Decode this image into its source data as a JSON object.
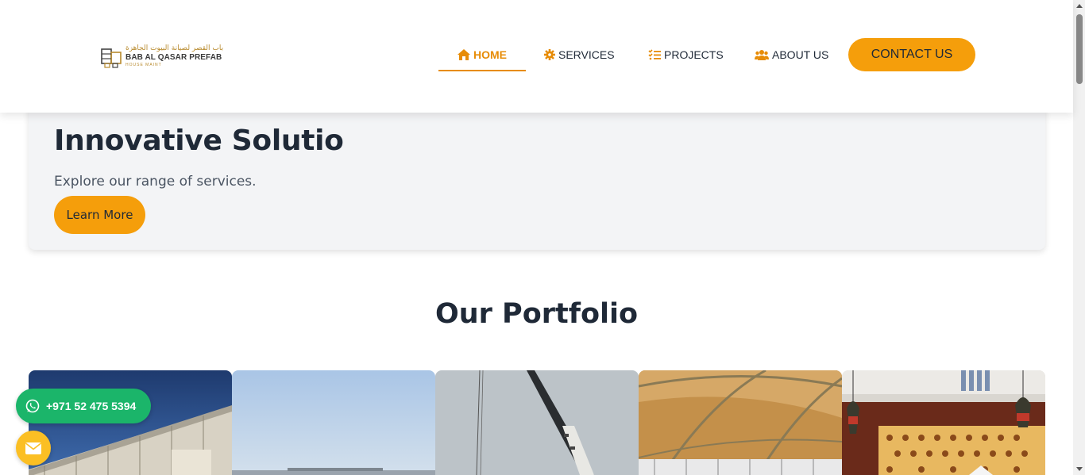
{
  "header": {
    "logo": {
      "arabic": "باب القصر لصيانة البيوت الجاهزة",
      "name": "BAB AL QASAR PREFAB",
      "sub": "HOUSE MAINT"
    },
    "nav": [
      {
        "label": "HOME",
        "icon": "home-icon",
        "active": true
      },
      {
        "label": "SERVICES",
        "icon": "gear-icon",
        "active": false
      },
      {
        "label": "PROJECTS",
        "icon": "list-check-icon",
        "active": false
      },
      {
        "label": "ABOUT US",
        "icon": "users-icon",
        "active": false
      }
    ],
    "contact_label": "CONTACT US"
  },
  "hero": {
    "title": "Innovative Solutio",
    "subtitle": "Explore our range of services.",
    "button_label": "Learn More"
  },
  "portfolio": {
    "title": "Our Portfolio"
  },
  "floating": {
    "whatsapp_number": "+971 52 475 5394"
  },
  "colors": {
    "accent": "#f59e0b",
    "nav_active": "#e78c07",
    "whatsapp": "#1bb56a",
    "mail": "#fbbf24",
    "text_dark": "#1f2937"
  }
}
